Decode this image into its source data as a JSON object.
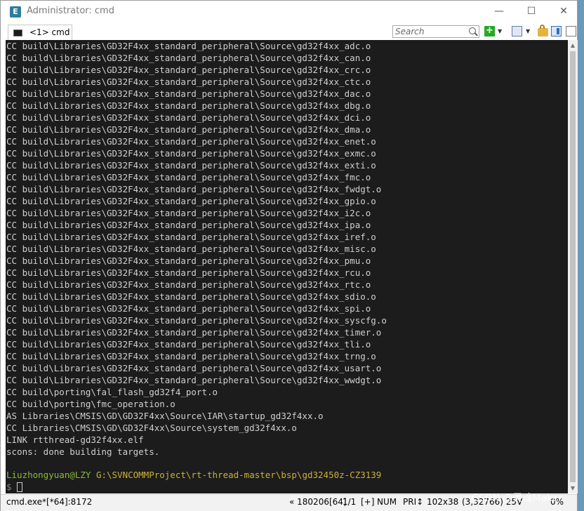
{
  "window": {
    "title": "Administrator: cmd",
    "app_icon_letter": "E",
    "controls": {
      "minimize": "—",
      "maximize": "☐",
      "close": "✕"
    }
  },
  "tabbar": {
    "tab_label": "<1> cmd",
    "search_placeholder": "Search",
    "add_symbol": "+",
    "dropdown_symbol": "▼"
  },
  "console": {
    "lines": [
      "CC build\\Libraries\\GD32F4xx_standard_peripheral\\Source\\gd32f4xx_adc.o",
      "CC build\\Libraries\\GD32F4xx_standard_peripheral\\Source\\gd32f4xx_can.o",
      "CC build\\Libraries\\GD32F4xx_standard_peripheral\\Source\\gd32f4xx_crc.o",
      "CC build\\Libraries\\GD32F4xx_standard_peripheral\\Source\\gd32f4xx_ctc.o",
      "CC build\\Libraries\\GD32F4xx_standard_peripheral\\Source\\gd32f4xx_dac.o",
      "CC build\\Libraries\\GD32F4xx_standard_peripheral\\Source\\gd32f4xx_dbg.o",
      "CC build\\Libraries\\GD32F4xx_standard_peripheral\\Source\\gd32f4xx_dci.o",
      "CC build\\Libraries\\GD32F4xx_standard_peripheral\\Source\\gd32f4xx_dma.o",
      "CC build\\Libraries\\GD32F4xx_standard_peripheral\\Source\\gd32f4xx_enet.o",
      "CC build\\Libraries\\GD32F4xx_standard_peripheral\\Source\\gd32f4xx_exmc.o",
      "CC build\\Libraries\\GD32F4xx_standard_peripheral\\Source\\gd32f4xx_exti.o",
      "CC build\\Libraries\\GD32F4xx_standard_peripheral\\Source\\gd32f4xx_fmc.o",
      "CC build\\Libraries\\GD32F4xx_standard_peripheral\\Source\\gd32f4xx_fwdgt.o",
      "CC build\\Libraries\\GD32F4xx_standard_peripheral\\Source\\gd32f4xx_gpio.o",
      "CC build\\Libraries\\GD32F4xx_standard_peripheral\\Source\\gd32f4xx_i2c.o",
      "CC build\\Libraries\\GD32F4xx_standard_peripheral\\Source\\gd32f4xx_ipa.o",
      "CC build\\Libraries\\GD32F4xx_standard_peripheral\\Source\\gd32f4xx_iref.o",
      "CC build\\Libraries\\GD32F4xx_standard_peripheral\\Source\\gd32f4xx_misc.o",
      "CC build\\Libraries\\GD32F4xx_standard_peripheral\\Source\\gd32f4xx_pmu.o",
      "CC build\\Libraries\\GD32F4xx_standard_peripheral\\Source\\gd32f4xx_rcu.o",
      "CC build\\Libraries\\GD32F4xx_standard_peripheral\\Source\\gd32f4xx_rtc.o",
      "CC build\\Libraries\\GD32F4xx_standard_peripheral\\Source\\gd32f4xx_sdio.o",
      "CC build\\Libraries\\GD32F4xx_standard_peripheral\\Source\\gd32f4xx_spi.o",
      "CC build\\Libraries\\GD32F4xx_standard_peripheral\\Source\\gd32f4xx_syscfg.o",
      "CC build\\Libraries\\GD32F4xx_standard_peripheral\\Source\\gd32f4xx_timer.o",
      "CC build\\Libraries\\GD32F4xx_standard_peripheral\\Source\\gd32f4xx_tli.o",
      "CC build\\Libraries\\GD32F4xx_standard_peripheral\\Source\\gd32f4xx_trng.o",
      "CC build\\Libraries\\GD32F4xx_standard_peripheral\\Source\\gd32f4xx_usart.o",
      "CC build\\Libraries\\GD32F4xx_standard_peripheral\\Source\\gd32f4xx_wwdgt.o",
      "CC build\\porting\\fal_flash_gd32f4_port.o",
      "CC build\\porting\\fmc_operation.o",
      "AS Libraries\\CMSIS\\GD\\GD32F4xx\\Source\\IAR\\startup_gd32f4xx.o",
      "CC Libraries\\CMSIS\\GD\\GD32F4xx\\Source\\system_gd32f4xx.o",
      "LINK rtthread-gd32f4xx.elf",
      "scons: done building targets."
    ],
    "prompt_user": "Liuzhongyuan@LZY",
    "prompt_path": "G:\\SVNCOMMProject\\rt-thread-master\\bsp\\gd32450z-CZ3139",
    "prompt_symbol": "$"
  },
  "statusbar": {
    "process": "cmd.exe*[*64]:8172",
    "position": "« 180206[64]",
    "page": "1/1",
    "insert": "[+]",
    "num": "NUM",
    "priority": "PRI↕",
    "size": "102x38",
    "cursor": "(3,32766) 25V",
    "percent": "0%"
  },
  "watermark": "CSDN @灵魂Maker"
}
